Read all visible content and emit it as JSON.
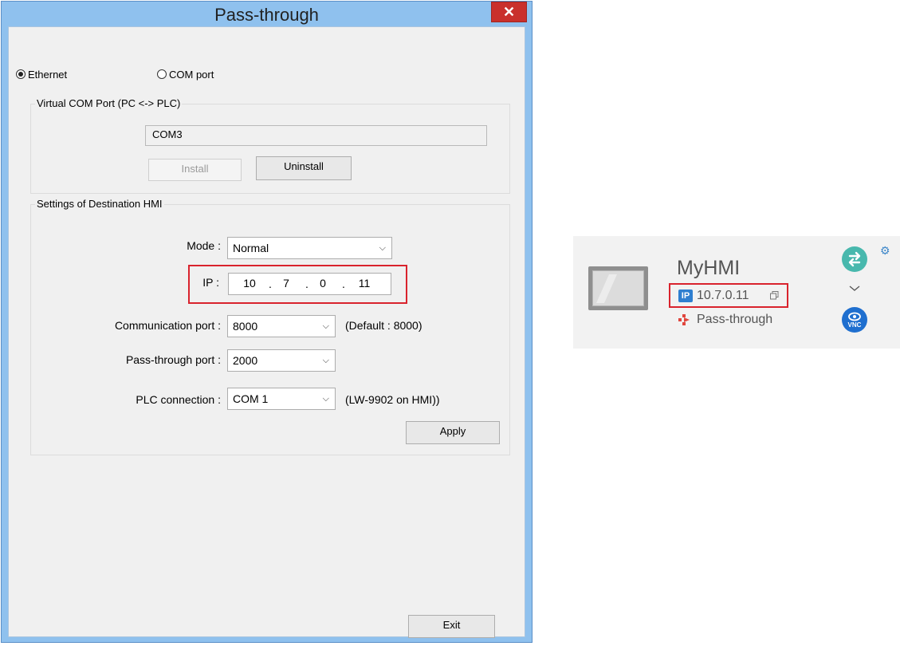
{
  "dialog": {
    "title": "Pass-through",
    "close_glyph": "✕",
    "connection": {
      "options": [
        "Ethernet",
        "COM port"
      ],
      "selected": "Ethernet"
    },
    "virtual_com": {
      "group_title": "Virtual COM Port (PC <-> PLC)",
      "port_value": "COM3",
      "install_label": "Install",
      "uninstall_label": "Uninstall"
    },
    "destination": {
      "group_title": "Settings of Destination HMI",
      "mode_label": "Mode :",
      "mode_value": "Normal",
      "ip_label": "IP :",
      "ip_octets": [
        "10",
        "7",
        "0",
        "11"
      ],
      "ip_dot": ".",
      "comm_port_label": "Communication port :",
      "comm_port_value": "8000",
      "comm_port_hint": "(Default : 8000)",
      "pt_port_label": "Pass-through port :",
      "pt_port_value": "2000",
      "plc_label": "PLC connection :",
      "plc_value": "COM 1",
      "plc_hint": "(LW-9902 on HMI))",
      "apply_label": "Apply"
    },
    "exit_label": "Exit"
  },
  "device_card": {
    "name": "MyHMI",
    "ip_badge": "IP",
    "ip": "10.7.0.11",
    "status": "Pass-through",
    "vnc_label": "VNC",
    "icons": {
      "screen": "hmi-screen-icon",
      "copy": "copy-icon",
      "pass_through": "pass-through-icon",
      "sync": "sync-arrows-icon",
      "settings": "gear-icon",
      "expand": "chevron-down-icon",
      "vnc": "vnc-eye-icon"
    },
    "colors": {
      "accent_blue": "#2f7fd0",
      "sync_teal": "#48b8ad",
      "vnc_blue": "#1f6fcf",
      "highlight_red": "#d9232d",
      "pass_through_red": "#e0463e"
    }
  }
}
